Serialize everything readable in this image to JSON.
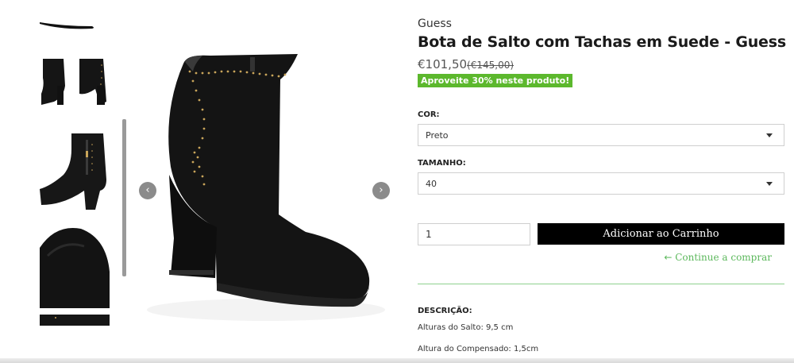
{
  "product": {
    "brand": "Guess",
    "title": "Bota de Salto com Tachas em Suede - Guess",
    "price": "€101,50",
    "old_price": "(€145,00)",
    "promo": "Aproveite 30% neste produto!"
  },
  "options": {
    "color_label": "COR:",
    "color_value": "Preto",
    "size_label": "TAMANHO:",
    "size_value": "40"
  },
  "cart": {
    "quantity": "1",
    "add_label": "Adicionar ao Carrinho",
    "continue_arrow": "←",
    "continue_label": "Continue a comprar"
  },
  "description": {
    "title": "DESCRIÇÃO:",
    "lines": [
      "Alturas do Salto: 9,5 cm",
      "Altura do Compensado: 1,5cm"
    ]
  },
  "gallery": {
    "prev_icon": "‹",
    "next_icon": "›"
  },
  "colors": {
    "accent_green": "#5cb82d",
    "link_green": "#5cb85c",
    "button_black": "#000000"
  }
}
